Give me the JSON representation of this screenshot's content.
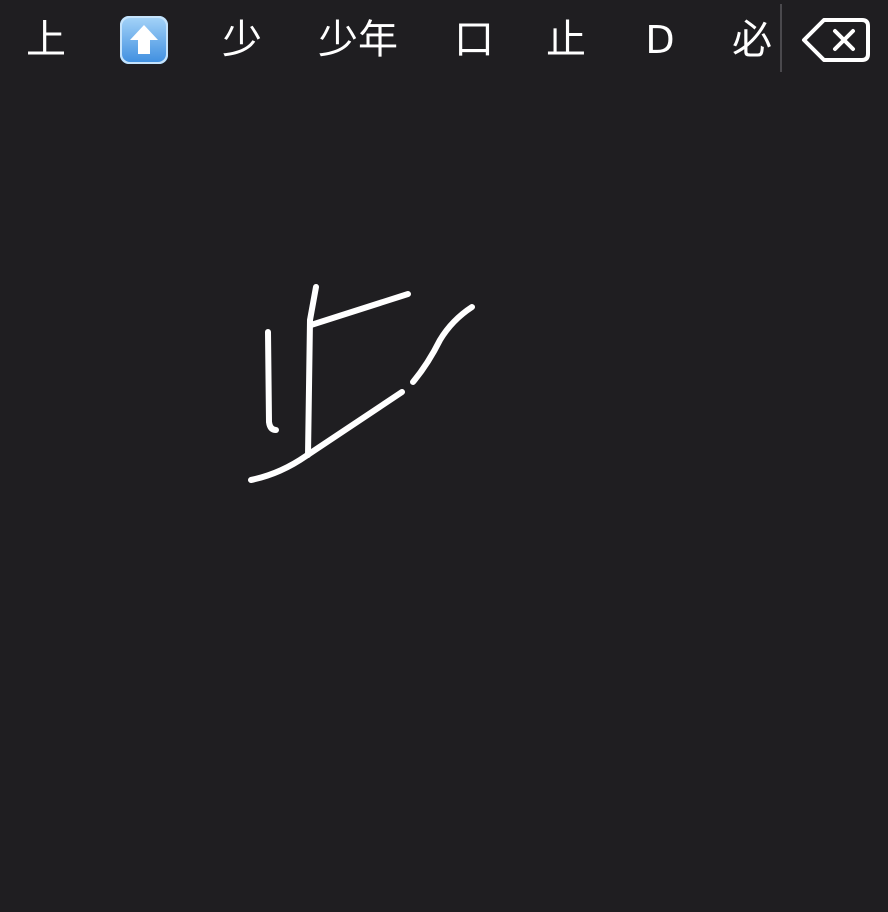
{
  "candidates": [
    {
      "label": "上"
    },
    {
      "label": "",
      "icon": "up-arrow-emoji-icon"
    },
    {
      "label": "少"
    },
    {
      "label": "少年"
    },
    {
      "label": "口"
    },
    {
      "label": "止"
    },
    {
      "label": "D"
    },
    {
      "label": "必"
    }
  ],
  "delete_icon": "backspace-icon",
  "colors": {
    "background": "#1f1e21",
    "text": "#ffffff",
    "emoji_blue": "#3e8fdf",
    "divider": "#4a494d"
  }
}
